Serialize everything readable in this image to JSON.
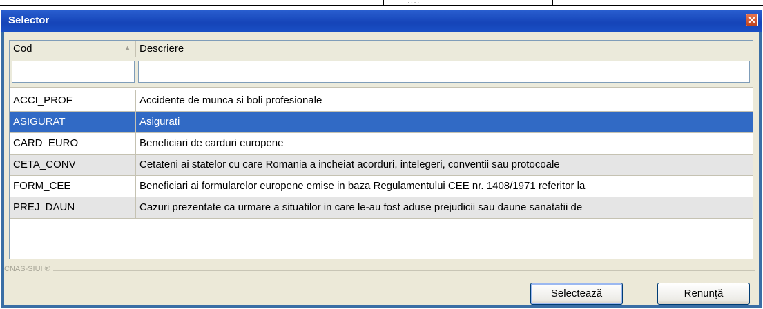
{
  "window": {
    "title": "Selector",
    "close_glyph": "✕"
  },
  "background": {
    "fragment_text": "...."
  },
  "grid": {
    "columns": [
      {
        "label": "Cod",
        "sort": "ascending"
      },
      {
        "label": "Descriere"
      }
    ],
    "filters": {
      "cod": "",
      "descriere": ""
    },
    "rows": [
      {
        "cod": "ACCI_PROF",
        "descriere": "Accidente de munca si boli profesionale",
        "selected": false,
        "alt": false
      },
      {
        "cod": "ASIGURAT",
        "descriere": "Asigurati",
        "selected": true,
        "alt": false
      },
      {
        "cod": "CARD_EURO",
        "descriere": "Beneficiari de carduri europene",
        "selected": false,
        "alt": false
      },
      {
        "cod": "CETA_CONV",
        "descriere": "Cetateni ai statelor cu care Romania a incheiat acorduri, intelegeri, conventii sau protocoale",
        "selected": false,
        "alt": true
      },
      {
        "cod": "FORM_CEE",
        "descriere": "Beneficiari ai formularelor europene emise in baza Regulamentului CEE nr. 1408/1971 referitor la",
        "selected": false,
        "alt": false
      },
      {
        "cod": "PREJ_DAUN",
        "descriere": "Cazuri prezentate ca urmare a situatilor in care le-au fost aduse prejudicii sau daune sanatatii de",
        "selected": false,
        "alt": true
      }
    ]
  },
  "footer": {
    "groupbox_label": "CNAS-SIUI ®",
    "select_button": "Selectează",
    "cancel_button": "Renunţă"
  },
  "colors": {
    "titlebar": "#1544b8",
    "selection": "#316ac5",
    "dialog_face": "#ece9d8"
  }
}
